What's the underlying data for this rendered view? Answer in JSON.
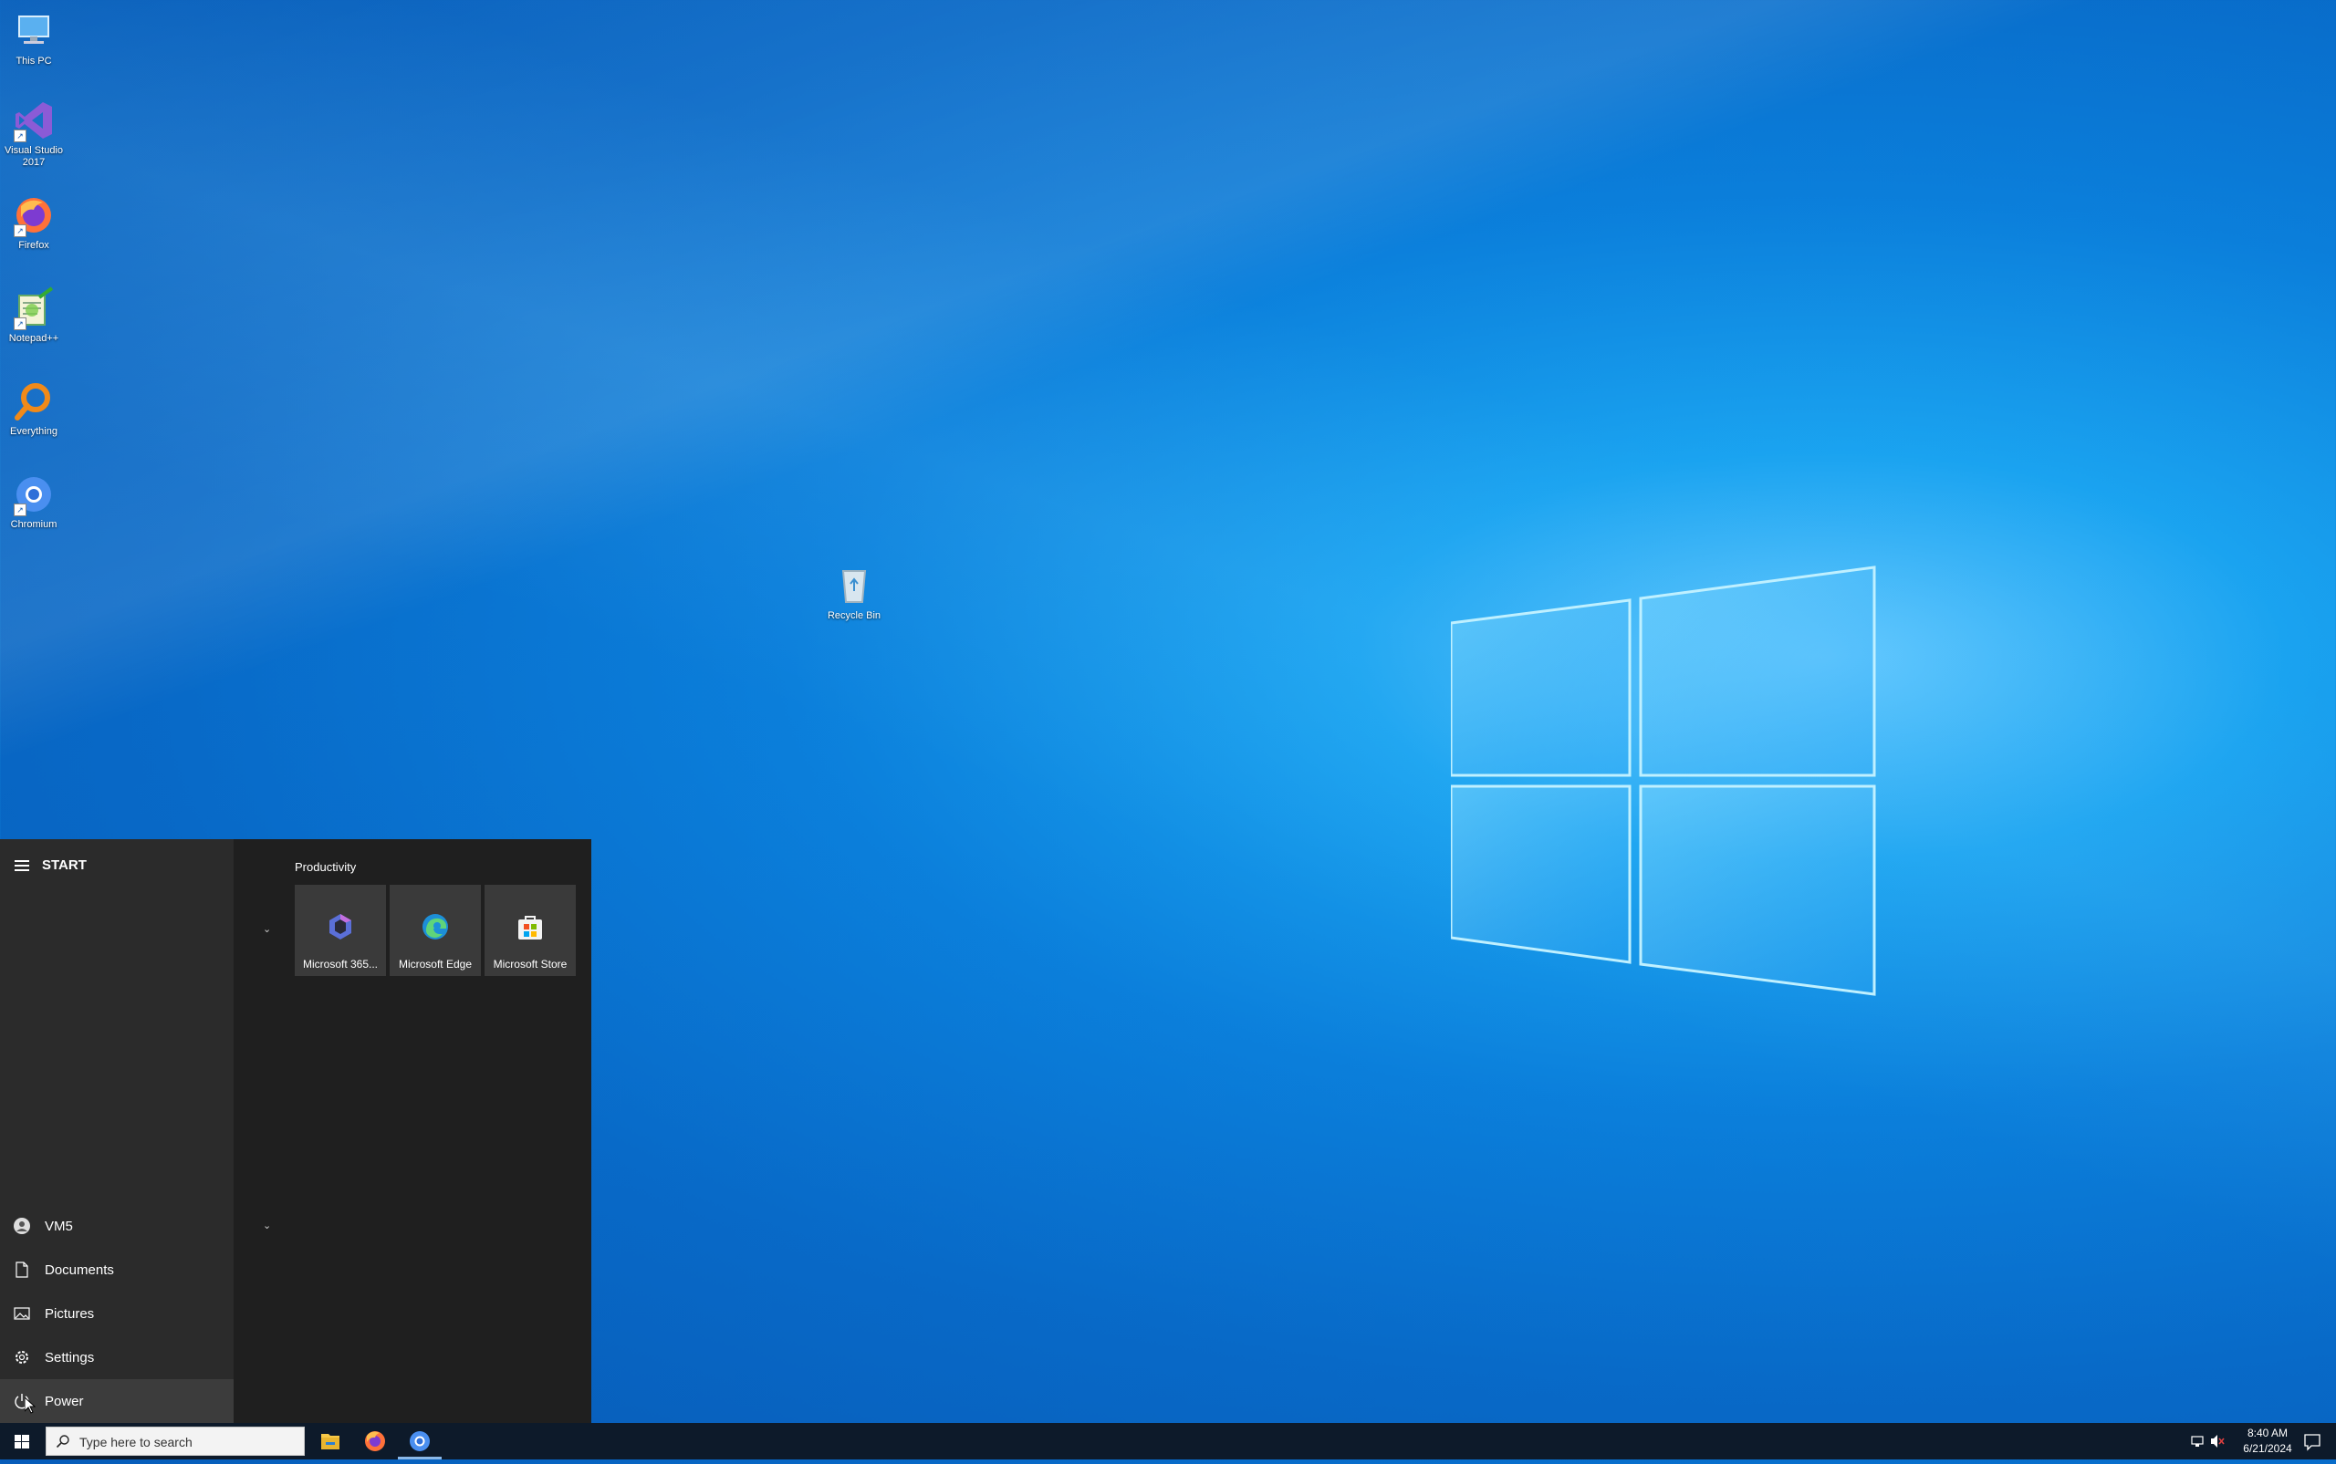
{
  "desktop": {
    "icons": [
      {
        "label": "This PC",
        "icon": "this-pc-icon"
      },
      {
        "label": "Visual Studio 2017",
        "icon": "visual-studio-icon"
      },
      {
        "label": "Firefox",
        "icon": "firefox-icon"
      },
      {
        "label": "Notepad++",
        "icon": "notepad-plus-plus-icon"
      },
      {
        "label": "Everything",
        "icon": "everything-icon"
      },
      {
        "label": "Chromium",
        "icon": "chromium-icon"
      },
      {
        "label": "Recycle Bin",
        "icon": "recycle-bin-icon"
      }
    ]
  },
  "start_menu": {
    "title": "START",
    "group_title": "Productivity",
    "tiles": [
      {
        "label": "Microsoft 365...",
        "icon": "microsoft-365-icon"
      },
      {
        "label": "Microsoft Edge",
        "icon": "edge-icon"
      },
      {
        "label": "Microsoft Store",
        "icon": "store-icon"
      }
    ],
    "items": [
      {
        "label": "VM5",
        "icon": "user-avatar-icon"
      },
      {
        "label": "Documents",
        "icon": "document-icon"
      },
      {
        "label": "Pictures",
        "icon": "pictures-icon"
      },
      {
        "label": "Settings",
        "icon": "gear-icon"
      },
      {
        "label": "Power",
        "icon": "power-icon"
      }
    ]
  },
  "taskbar": {
    "search_placeholder": "Type here to search",
    "apps": [
      "file-explorer-icon",
      "firefox-icon",
      "chromium-icon"
    ],
    "clock_time": "8:40 AM",
    "clock_date": "6/21/2024"
  },
  "colors": {
    "accent": "#0078d7",
    "start_bg": "#1f1f1f",
    "start_left_bg": "#2b2b2b",
    "taskbar_bg": "#0d1a2a"
  }
}
